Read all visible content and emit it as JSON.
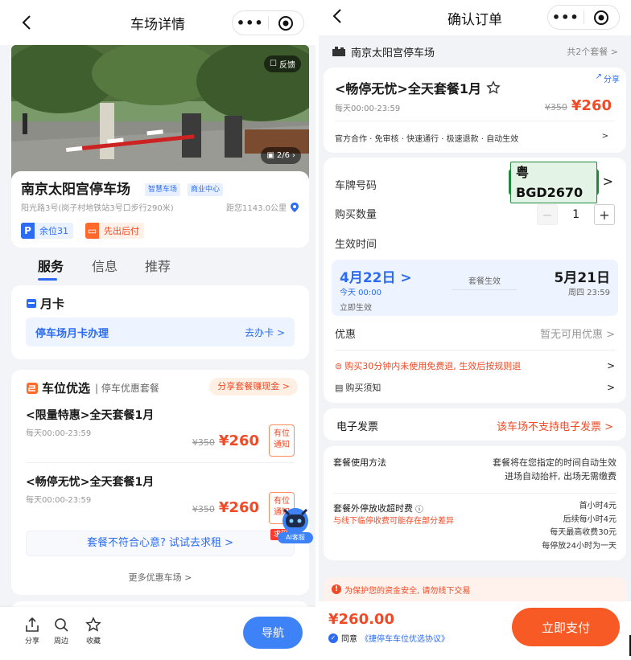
{
  "left": {
    "nav_title": "车场详情",
    "feedback_label": "反馈",
    "photo_counter": "2/6",
    "lot_name": "南京太阳宫停车场",
    "tags": [
      "智慧车场",
      "商业中心"
    ],
    "address": "阳光路3号(岗子村地铁站3号口步行290米)",
    "distance": "距您1143.0公里",
    "spaces_label": "余位31",
    "pay_mode_label": "先出后付",
    "tabs": [
      "服务",
      "信息",
      "推荐"
    ],
    "monthly": {
      "title": "月卡",
      "link_label": "停车场月卡办理",
      "link_action": "去办卡 >"
    },
    "deals": {
      "title": "车位优选",
      "subtitle": "停车优惠套餐",
      "share_label": "分享套餐赚现金 >",
      "packages": [
        {
          "name": "<限量特惠>全天套餐1月",
          "time": "每天00:00-23:59",
          "old_price": "¥350",
          "price": "¥260",
          "notify": "有位\n通知"
        },
        {
          "name": "<畅停无忧>全天套餐1月",
          "time": "每天00:00-23:59",
          "old_price": "¥350",
          "price": "¥260",
          "notify": "有位\n通知"
        }
      ],
      "rent_prompt": "套餐不符合心意? 试试去求租 >",
      "rent_tag": "求租",
      "more_label": "更多优惠车场 >",
      "ai_label": "AI客服"
    },
    "bottom": {
      "share": "分享",
      "nearby": "周边",
      "favorite": "收藏",
      "navigate": "导航"
    }
  },
  "right": {
    "nav_title": "确认订单",
    "lot_name": "南京太阳宫停车场",
    "package_count": "共2个套餐 >",
    "share_label": "分享",
    "package_name": "<畅停无忧>全天套餐1月",
    "package_time": "每天00:00-23:59",
    "old_price": "¥350",
    "price": "¥260",
    "features": "官方合作 · 免审核 · 快速通行 · 极速退款 · 自动生效",
    "plate_label": "车牌号码",
    "plate": "粤BGD2670",
    "qty_label": "购买数量",
    "qty": "1",
    "effective_label": "生效时间",
    "start_date": "4月22日 >",
    "start_time": "今天 00:00",
    "start_note": "立即生效",
    "mid_label": "套餐生效",
    "end_date": "5月21日",
    "end_time": "周四 23:59",
    "discount_label": "优惠",
    "discount_value": "暂无可用优惠 >",
    "refund_note": "购买30分钟内未使用免费退, 生效后按规则退",
    "notice_label": "购买须知",
    "invoice_label": "电子发票",
    "invoice_value": "该车场不支持电子发票 >",
    "usage_label": "套餐使用方法",
    "usage_text": [
      "套餐将在您指定的时间自动生效",
      "进场自动抬杆, 出场无需缴费"
    ],
    "overtime_label": "套餐外停放收超时费",
    "overtime_note": "与线下临停收费可能存在部分差异",
    "overtime_rules": [
      "首小时4元",
      "后续每小时4元",
      "每天最高收费30元",
      "每停放24小时为一天"
    ],
    "safety": "为保护您的资金安全, 请勿线下交易",
    "total": "¥260.00",
    "agree_prefix": "同意",
    "agree_link": "《捷停车车位优选协议》",
    "pay_label": "立即支付"
  },
  "colors": {
    "blue": "#2c6bf2",
    "orange": "#f04a26",
    "pay": "#f75a24",
    "plate_green": "#2ea84f"
  }
}
